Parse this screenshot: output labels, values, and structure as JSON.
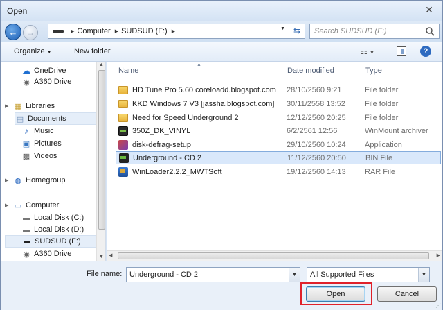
{
  "window": {
    "title": "Open"
  },
  "address": {
    "crumbs": [
      "Computer",
      "SUDSUD (F:)"
    ],
    "search_placeholder": "Search SUDSUD (F:)"
  },
  "toolbar": {
    "organize_label": "Organize",
    "newfolder_label": "New folder"
  },
  "nav": {
    "items": [
      {
        "label": "OneDrive",
        "icon": "cloud-icon"
      },
      {
        "label": "A360 Drive",
        "icon": "drive-eye-icon"
      },
      {
        "label": "Libraries",
        "icon": "libraries-icon"
      },
      {
        "label": "Documents",
        "icon": "documents-icon"
      },
      {
        "label": "Music",
        "icon": "music-icon"
      },
      {
        "label": "Pictures",
        "icon": "pictures-icon"
      },
      {
        "label": "Videos",
        "icon": "videos-icon"
      },
      {
        "label": "Homegroup",
        "icon": "homegroup-icon"
      },
      {
        "label": "Computer",
        "icon": "computer-icon"
      },
      {
        "label": "Local Disk (C:)",
        "icon": "local-disk-icon"
      },
      {
        "label": "Local Disk (D:)",
        "icon": "local-disk-icon"
      },
      {
        "label": "SUDSUD (F:)",
        "icon": "usb-drive-icon"
      },
      {
        "label": "A360 Drive",
        "icon": "drive-eye-icon"
      }
    ]
  },
  "columns": {
    "name": "Name",
    "date": "Date modified",
    "type": "Type"
  },
  "files": [
    {
      "name": "HD Tune Pro 5.60 coreloadd.blogspot.com",
      "date": "28/10/2560 9:21",
      "type": "File folder",
      "icon": "folder-icon"
    },
    {
      "name": "KKD Windows 7 V3 [jassha.blogspot.com]",
      "date": "30/11/2558 13:52",
      "type": "File folder",
      "icon": "folder-icon"
    },
    {
      "name": "Need for Speed Underground 2",
      "date": "12/12/2560 20:25",
      "type": "File folder",
      "icon": "folder-icon"
    },
    {
      "name": "350Z_DK_VINYL",
      "date": "6/2/2561 12:56",
      "type": "WinMount archiver",
      "icon": "archive-icon"
    },
    {
      "name": "disk-defrag-setup",
      "date": "29/10/2560 10:24",
      "type": "Application",
      "icon": "setup-icon"
    },
    {
      "name": "Underground - CD 2",
      "date": "11/12/2560 20:50",
      "type": "BIN File",
      "icon": "bin-file-icon"
    },
    {
      "name": "WinLoader2.2.2_MWTSoft",
      "date": "19/12/2560 14:13",
      "type": "RAR File",
      "icon": "rar-file-icon"
    }
  ],
  "bottom": {
    "filename_label": "File name:",
    "filename_value": "Underground - CD 2",
    "filter_value": "All Supported Files",
    "open_label": "Open",
    "cancel_label": "Cancel"
  },
  "colors": {
    "highlight": "#e0212a",
    "selection": "#d9e8fb",
    "accent": "#2d6ac0"
  }
}
